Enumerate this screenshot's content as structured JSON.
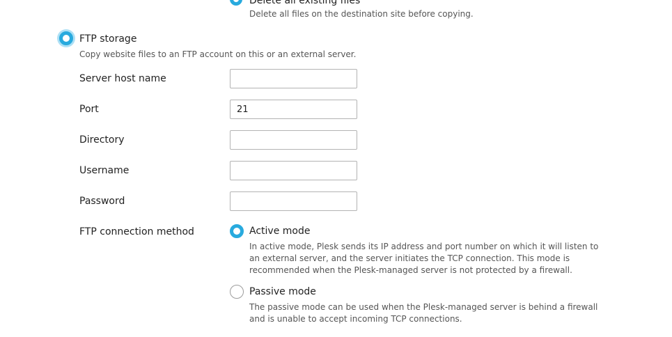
{
  "top_option": {
    "label": "Delete all existing files",
    "hint": "Delete all files on the destination site before copying."
  },
  "ftp_storage": {
    "label": "FTP storage",
    "hint": "Copy website files to an FTP account on this or an external server.",
    "selected": true
  },
  "fields": {
    "host": {
      "label": "Server host name",
      "value": ""
    },
    "port": {
      "label": "Port",
      "value": "21"
    },
    "directory": {
      "label": "Directory",
      "value": ""
    },
    "username": {
      "label": "Username",
      "value": ""
    },
    "password": {
      "label": "Password",
      "value": ""
    }
  },
  "connection_method": {
    "label": "FTP connection method",
    "active": {
      "label": "Active mode",
      "hint": "In active mode, Plesk sends its IP address and port number on which it will listen to an external server, and the server initiates the TCP connection. This mode is recommended when the Plesk-managed server is not protected by a firewall.",
      "selected": true
    },
    "passive": {
      "label": "Passive mode",
      "hint": "The passive mode can be used when the Plesk-managed server is behind a firewall and is unable to accept incoming TCP connections.",
      "selected": false
    }
  },
  "colors": {
    "accent": "#28aade",
    "focus_halo": "#aee0f5",
    "hint_text": "#555555",
    "input_border": "#b3b3b3"
  }
}
